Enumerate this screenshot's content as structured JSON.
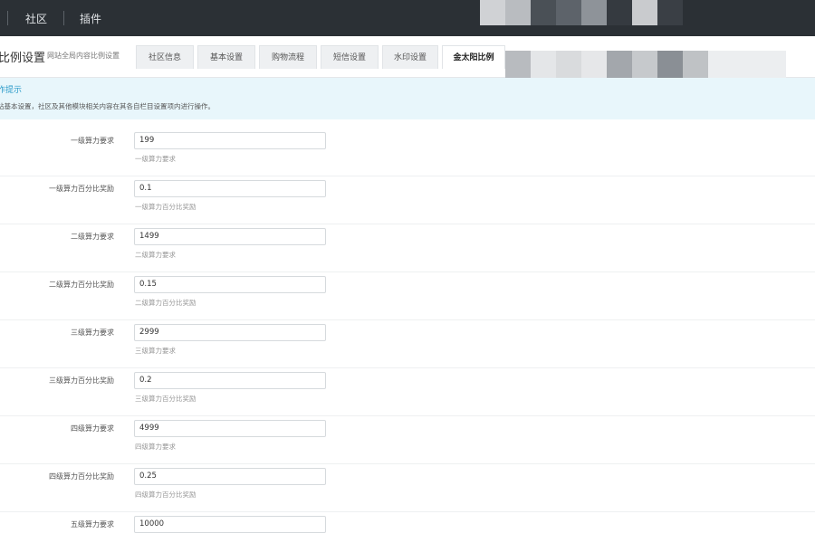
{
  "topbar": {
    "nav": [
      {
        "label": "社区"
      },
      {
        "label": "插件"
      }
    ]
  },
  "page": {
    "title": "比例设置",
    "subtitle": "网站全局内容比例设置"
  },
  "tabs": [
    {
      "label": "社区信息"
    },
    {
      "label": "基本设置"
    },
    {
      "label": "购物流程"
    },
    {
      "label": "短信设置"
    },
    {
      "label": "水印设置"
    },
    {
      "label": "金太阳比例",
      "active": true
    }
  ],
  "hint": {
    "title": "作提示",
    "text": "站基本设置，社区及其他模块相关内容在其各自栏目设置项内进行操作。"
  },
  "fields": [
    {
      "label": "一级算力要求",
      "value": "199",
      "tip": "一级算力要求"
    },
    {
      "label": "一级算力百分比奖励",
      "value": "0.1",
      "tip": "一级算力百分比奖励"
    },
    {
      "label": "二级算力要求",
      "value": "1499",
      "tip": "二级算力要求"
    },
    {
      "label": "二级算力百分比奖励",
      "value": "0.15",
      "tip": "二级算力百分比奖励"
    },
    {
      "label": "三级算力要求",
      "value": "2999",
      "tip": "三级算力要求"
    },
    {
      "label": "三级算力百分比奖励",
      "value": "0.2",
      "tip": "三级算力百分比奖励"
    },
    {
      "label": "四级算力要求",
      "value": "4999",
      "tip": "四级算力要求"
    },
    {
      "label": "四级算力百分比奖励",
      "value": "0.25",
      "tip": "四级算力百分比奖励"
    },
    {
      "label": "五级算力要求",
      "value": "10000",
      "tip": ""
    }
  ]
}
